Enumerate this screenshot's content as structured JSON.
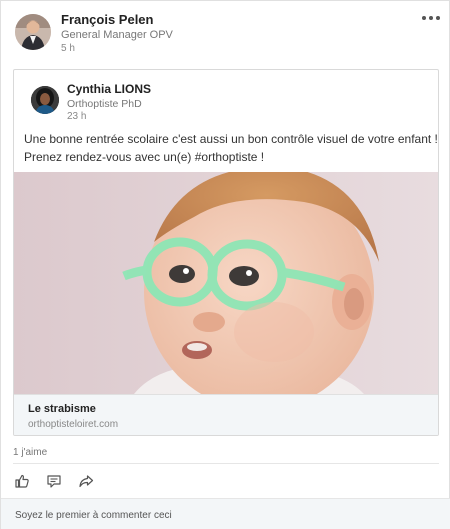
{
  "post": {
    "author_name": "François Pelen",
    "author_title": "General Manager OPV",
    "time": "5 h",
    "more_icon": "more-options-icon"
  },
  "shared": {
    "author_name": "Cynthia LIONS",
    "author_title": "Orthoptiste PhD",
    "time": "23 h",
    "text_line1": "Une bonne rentrée scolaire c'est aussi un bon contrôle visuel de votre enfant !",
    "text_line2": "Prenez rendez-vous avec un(e) #orthoptiste !",
    "link_title": "Le strabisme",
    "link_domain": "orthoptisteloiret.com"
  },
  "social": {
    "likes": "1 j'aime",
    "actions": [
      "like-icon",
      "comment-icon",
      "share-icon"
    ],
    "comment_prompt": "Soyez le premier à commenter ceci"
  },
  "colors": {
    "accent_lens": "#8ee6b5",
    "background": "#ffffff",
    "footer_bg": "#f3f6f8"
  }
}
